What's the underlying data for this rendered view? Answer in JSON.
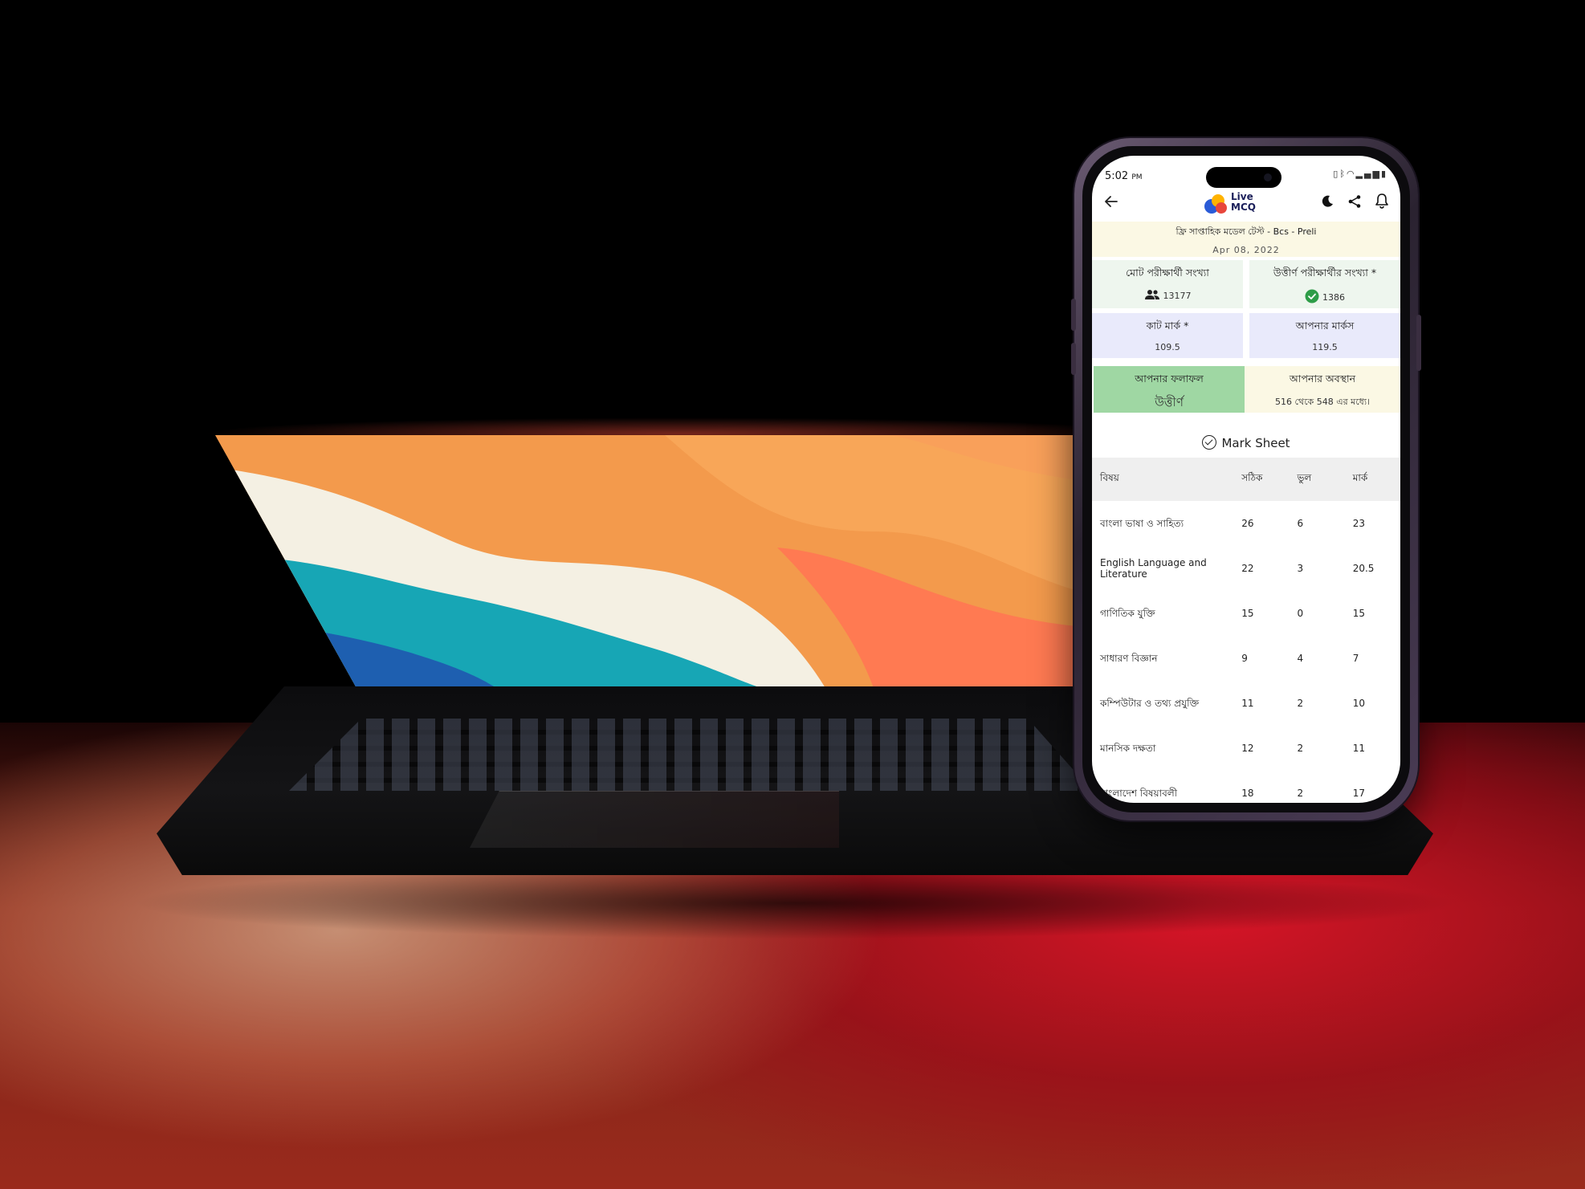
{
  "status_bar": {
    "time": "5:02",
    "ampm": "PM"
  },
  "app": {
    "logo_line1": "Live",
    "logo_line2": "MCQ",
    "icons": [
      "back-arrow-icon",
      "dark-mode-moon-icon",
      "share-icon",
      "notification-bell-icon"
    ]
  },
  "exam": {
    "title": "ফ্রি সাপ্তাহিক মডেল টেস্ট - Bcs - Preli",
    "date": "Apr 08, 2022"
  },
  "stats": {
    "total_examinees_label": "মোট পরীক্ষার্থী সংখ্যা",
    "total_examinees_value": "13177",
    "passed_examinees_label": "উত্তীর্ণ পরীক্ষার্থীর সংখ্যা *",
    "passed_examinees_value": "1386",
    "cut_mark_label": "কাট মার্ক *",
    "cut_mark_value": "109.5",
    "your_marks_label": "আপনার মার্কস",
    "your_marks_value": "119.5",
    "result_label": "আপনার ফলাফল",
    "result_value": "উত্তীর্ণ",
    "position_label": "আপনার অবস্থান",
    "position_value": "516 থেকে 548 এর মধ্যে।"
  },
  "mark_sheet": {
    "title": "Mark Sheet",
    "headers": {
      "subject": "বিষয়",
      "correct": "সঠিক",
      "wrong": "ভুল",
      "mark": "মার্ক"
    },
    "rows": [
      {
        "subject": "বাংলা ভাষা ও সাহিত্য",
        "correct": "26",
        "wrong": "6",
        "mark": "23"
      },
      {
        "subject": "English Language and Literature",
        "correct": "22",
        "wrong": "3",
        "mark": "20.5"
      },
      {
        "subject": "গাণিতিক যুক্তি",
        "correct": "15",
        "wrong": "0",
        "mark": "15"
      },
      {
        "subject": "সাধারণ বিজ্ঞান",
        "correct": "9",
        "wrong": "4",
        "mark": "7"
      },
      {
        "subject": "কম্পিউটার ও তথ্য প্রযুক্তি",
        "correct": "11",
        "wrong": "2",
        "mark": "10"
      },
      {
        "subject": "মানসিক দক্ষতা",
        "correct": "12",
        "wrong": "2",
        "mark": "11"
      },
      {
        "subject": "বাংলাদেশ বিষয়াবলী",
        "correct": "18",
        "wrong": "2",
        "mark": "17"
      }
    ]
  },
  "colors": {
    "banner_bg": "#fbf8e4",
    "stat_green_bg": "#eef6ee",
    "stat_lavender_bg": "#e9eafb",
    "pass_bg": "#9fd7a3",
    "check_green": "#2e9d48",
    "logo_navy": "#1b1f5a"
  }
}
